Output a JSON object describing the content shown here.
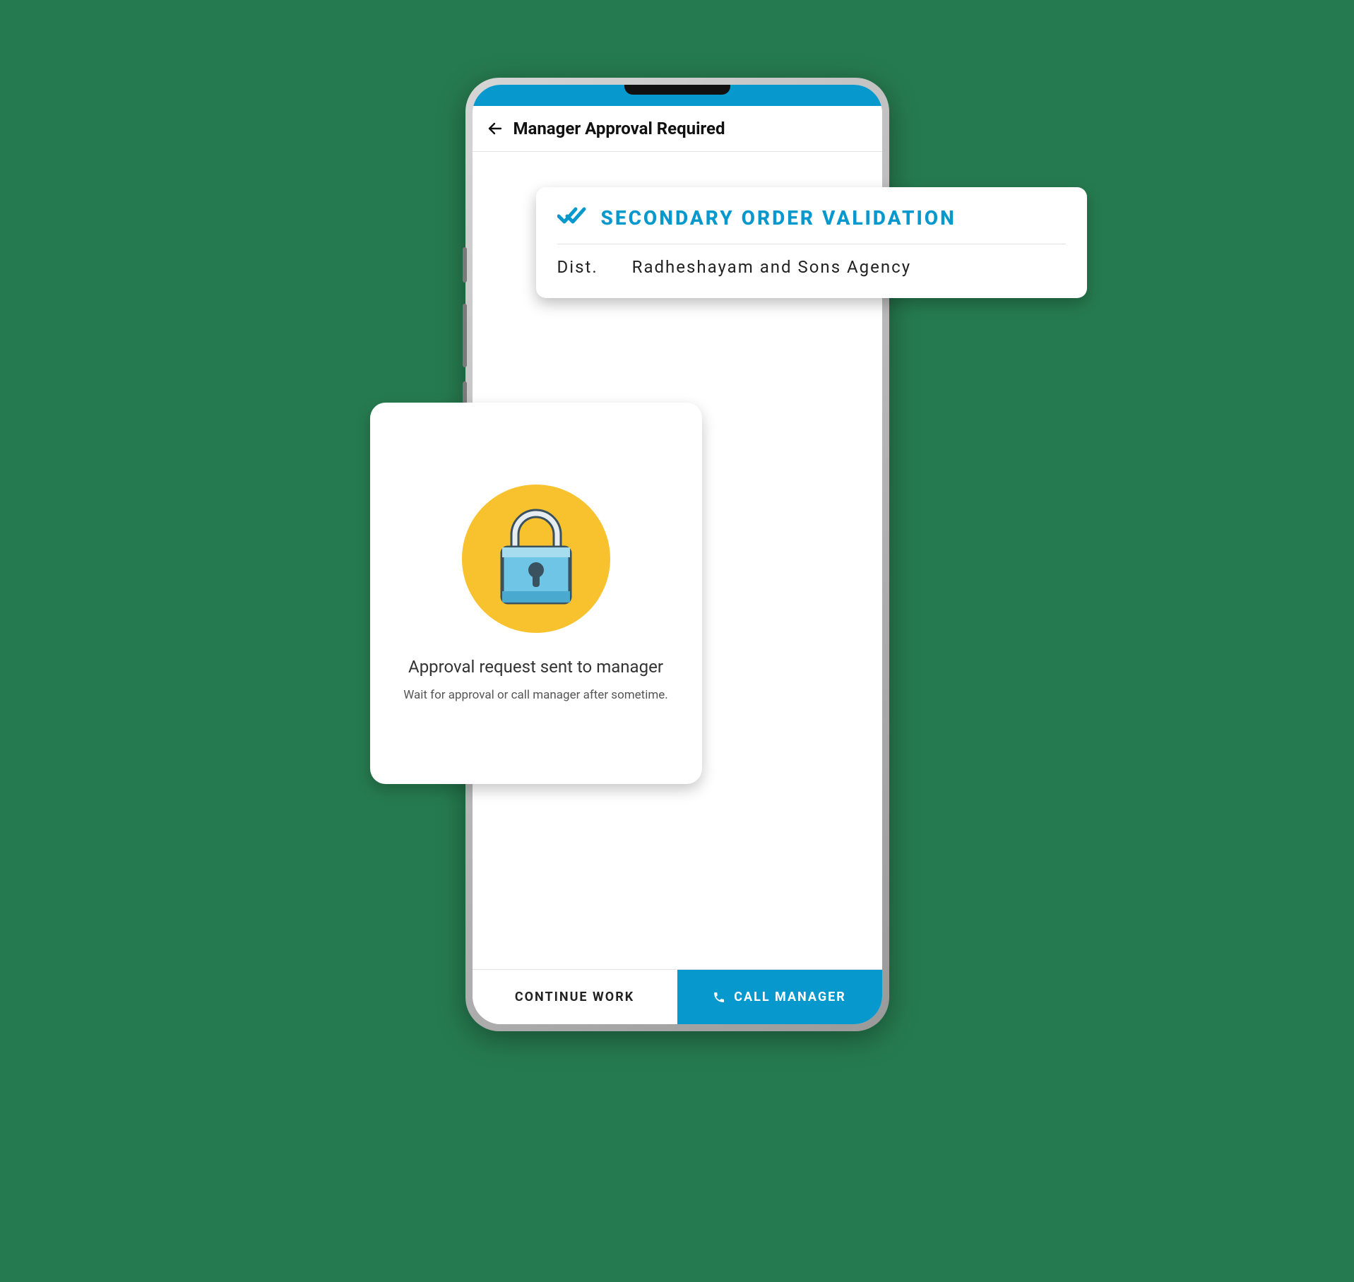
{
  "colors": {
    "accent": "#0798cd",
    "lock_circle": "#f7c22e",
    "lock_body": "#6fc5e6",
    "background": "#267a4f"
  },
  "header": {
    "title": "Manager Approval Required"
  },
  "validation_card": {
    "title": "SECONDARY ORDER VALIDATION",
    "dist_label": "Dist.",
    "dist_value": "Radheshayam and Sons Agency"
  },
  "approval_card": {
    "title": "Approval request sent to manager",
    "subtitle": "Wait for approval or call manager after sometime."
  },
  "footer": {
    "left_label": "CONTINUE WORK",
    "right_label": "CALL MANAGER"
  },
  "icons": {
    "back": "arrow-left-icon",
    "double_check": "double-check-icon",
    "lock": "lock-icon",
    "phone": "phone-icon"
  }
}
